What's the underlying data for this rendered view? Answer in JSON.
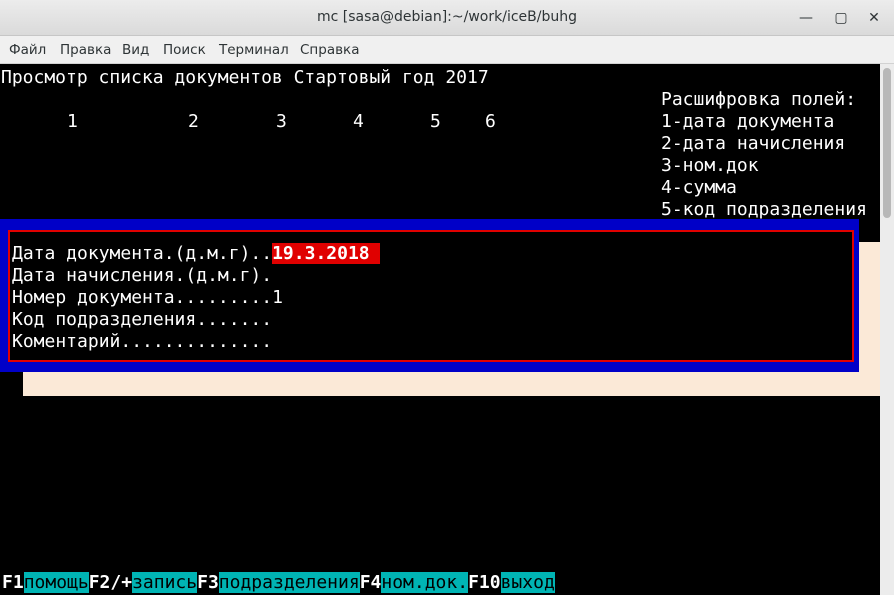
{
  "window": {
    "title": "mc [sasa@debian]:~/work/iceB/buhg",
    "minimize": "—",
    "maximize": "▢",
    "close": "✕"
  },
  "menu": [
    "Файл",
    "Правка",
    "Вид",
    "Поиск",
    "Терминал",
    "Справка"
  ],
  "screen": {
    "header": "Просмотр списка документов Стартовый год 2017",
    "column_numbers": [
      "1",
      "2",
      "3",
      "4",
      "5",
      "6"
    ],
    "legend_title": "Расшифровка полей:",
    "legend": [
      "1-дата документа",
      "2-дата начисления",
      "3-ном.док",
      "4-сумма",
      "5-код подразделения"
    ]
  },
  "dialog": {
    "fields": [
      {
        "label": "Дата документа.(д.м.г)..",
        "value": "19.3.2018"
      },
      {
        "label": "Дата начисления.(д.м.г).",
        "value": ""
      },
      {
        "label": "Номер документа.........",
        "value": "1"
      },
      {
        "label": "Код подразделения.......",
        "value": ""
      },
      {
        "label": "Коментарий..............",
        "value": ""
      }
    ]
  },
  "function_keys": [
    {
      "key": "F1",
      "label": "помощь"
    },
    {
      "key": "F2/+",
      "label": "запись"
    },
    {
      "key": "F3",
      "label": "подразделения"
    },
    {
      "key": "F4",
      "label": "ном.док."
    },
    {
      "key": "F10",
      "label": "выход"
    }
  ],
  "colors": {
    "dialog_border": "#0000c8",
    "dialog_frame": "#e10000",
    "highlight": "#e00000",
    "fkey_label_bg": "#00b4b4",
    "shadow": "#fbe9d7"
  }
}
